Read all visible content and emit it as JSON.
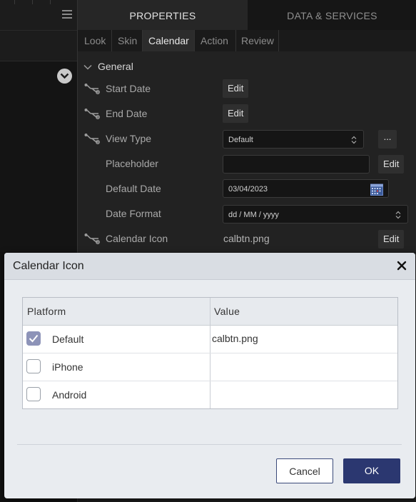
{
  "top_tabs": {
    "properties": "PROPERTIES",
    "data_services": "DATA & SERVICES"
  },
  "sub_tabs": [
    "Look",
    "Skin",
    "Calendar",
    "Action",
    "Review"
  ],
  "active_sub_tab": "Calendar",
  "section": {
    "label": "General"
  },
  "properties": {
    "start_date": {
      "label": "Start Date",
      "button": "Edit"
    },
    "end_date": {
      "label": "End Date",
      "button": "Edit"
    },
    "view_type": {
      "label": "View Type",
      "value": "Default",
      "more": "..."
    },
    "placeholder": {
      "label": "Placeholder",
      "value": "",
      "button": "Edit"
    },
    "default_date": {
      "label": "Default Date",
      "value": "03/04/2023"
    },
    "date_format": {
      "label": "Date Format",
      "value": "dd / MM / yyyy"
    },
    "calendar_icon": {
      "label": "Calendar Icon",
      "value": "calbtn.png",
      "button": "Edit"
    }
  },
  "dialog": {
    "title": "Calendar Icon",
    "columns": {
      "platform": "Platform",
      "value": "Value"
    },
    "rows": [
      {
        "platform": "Default",
        "value": "calbtn.png",
        "checked": true
      },
      {
        "platform": "iPhone",
        "value": "",
        "checked": false
      },
      {
        "platform": "Android",
        "value": "",
        "checked": false
      }
    ],
    "cancel": "Cancel",
    "ok": "OK"
  },
  "icons": [
    "hamburger-icon",
    "chevron-down-icon",
    "collapse-chevron-icon",
    "link-icon",
    "up-down-icon",
    "calendar-icon",
    "close-icon",
    "checkmark-icon"
  ],
  "colors": {
    "ok_button": "#2b3770",
    "checkbox_checked": "#8d93b8",
    "dialog_bg": "#e9ecf0"
  }
}
